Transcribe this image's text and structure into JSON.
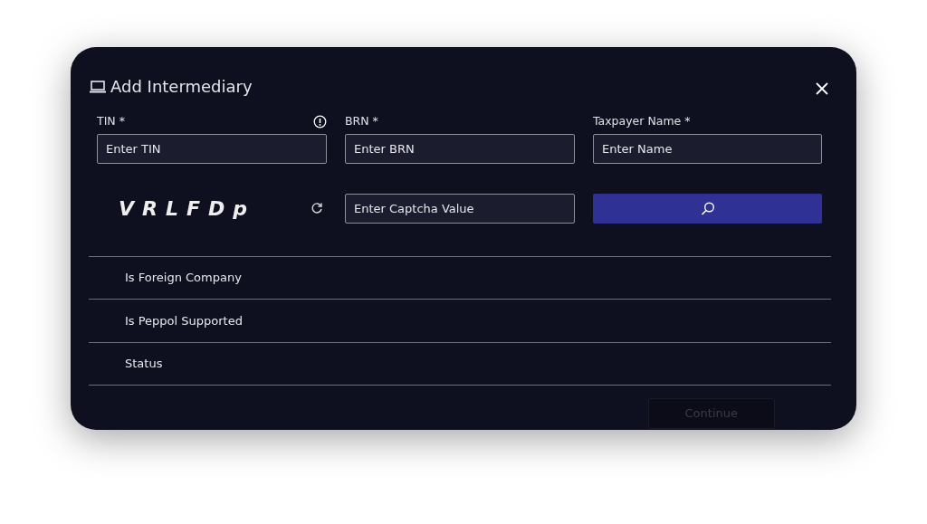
{
  "dialog": {
    "title": "Add Intermediary"
  },
  "fields": [
    {
      "label": "TIN *",
      "placeholder": "Enter TIN",
      "info": true
    },
    {
      "label": "BRN *",
      "placeholder": "Enter BRN",
      "info": false
    },
    {
      "label": "Taxpayer Name *",
      "placeholder": "Enter Name",
      "info": false
    }
  ],
  "captcha": {
    "code": "VRLFDp",
    "placeholder": "Enter Captcha Value"
  },
  "details": [
    {
      "label": "Is Foreign Company"
    },
    {
      "label": "Is Peppol Supported"
    },
    {
      "label": "Status"
    }
  ],
  "footer": {
    "button": "Continue",
    "disabled": true
  }
}
